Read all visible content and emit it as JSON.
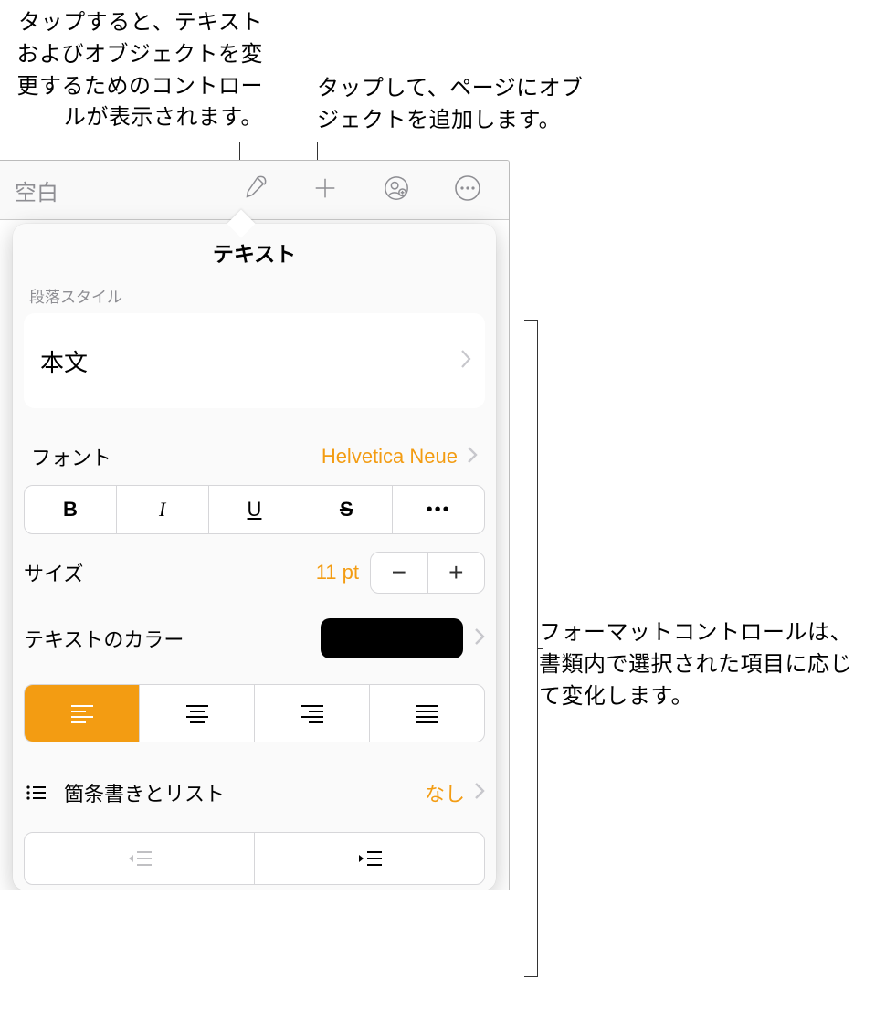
{
  "callouts": {
    "format_button": "タップすると、テキストおよびオブジェクトを変更するためのコントロールが表示されます。",
    "insert_button": "タップして、ページにオブジェクトを追加します。",
    "format_panel": "フォーマットコントロールは、書類内で選択された項目に応じて変化します。"
  },
  "toolbar": {
    "doc_title": "空白"
  },
  "popover": {
    "title": "テキスト",
    "paragraph_style": {
      "label": "段落スタイル",
      "value": "本文"
    },
    "font": {
      "label": "フォント",
      "value": "Helvetica Neue"
    },
    "style_buttons": {
      "bold": "B",
      "italic": "I",
      "underline": "U",
      "strike": "S"
    },
    "size": {
      "label": "サイズ",
      "value": "11 pt"
    },
    "text_color": {
      "label": "テキストのカラー",
      "value_hex": "#000000"
    },
    "bullets": {
      "label": "箇条書きとリスト",
      "value": "なし"
    }
  },
  "colors": {
    "accent": "#f39c12"
  }
}
